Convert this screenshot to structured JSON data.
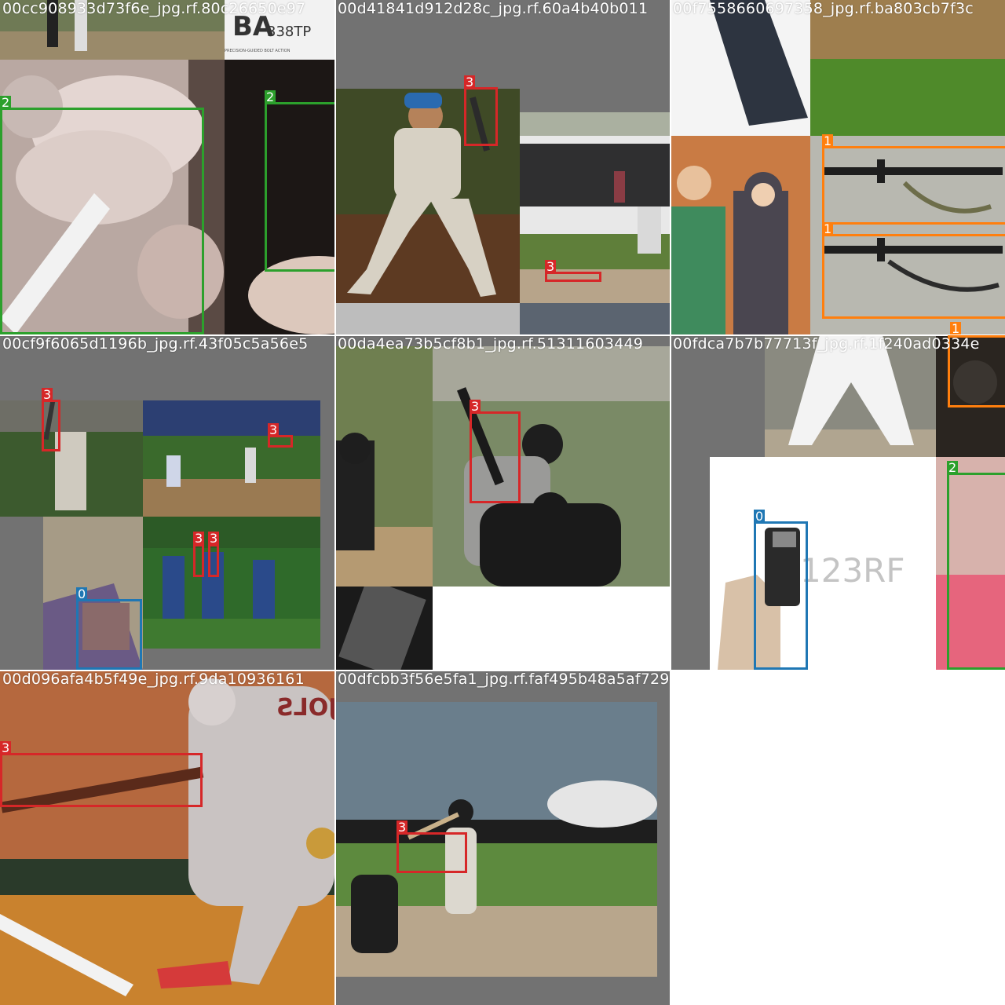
{
  "mosaic": {
    "tiles": [
      {
        "title": "00cc908933d73f6e_jpg.rf.80c26650e97",
        "labels": [
          "2",
          "2"
        ]
      },
      {
        "title": "00d41841d912d28c_jpg.rf.60a4b40b011",
        "labels": [
          "3",
          "3"
        ]
      },
      {
        "title": "00f7558660697358_jpg.rf.ba803cb7f3c",
        "labels": [
          "1",
          "1",
          "1"
        ]
      },
      {
        "title": "00cf9f6065d1196b_jpg.rf.43f05c5a56e5",
        "labels": [
          "3",
          "3",
          "3",
          "3",
          "0"
        ]
      },
      {
        "title": "00da4ea73b5cf8b1_jpg.rf.51311603449",
        "labels": [
          "3"
        ]
      },
      {
        "title": "00fdca7b7b77713f_jpg.rf.1f240ad0334e",
        "labels": [
          "2",
          "0"
        ]
      },
      {
        "title": "00d096afa4b5f49e_jpg.rf.9da10936161",
        "labels": [
          "3"
        ]
      },
      {
        "title": "00dfcbb3f56e5fa1_jpg.rf.faf495b48a5af729",
        "labels": [
          "3"
        ]
      }
    ],
    "scene_text": {
      "bolt_brand": "BA",
      "bolt_model": "338TP",
      "bolt_tagline": "PRECISION-GUIDED BOLT ACTION",
      "stock_watermark": "123RF",
      "jersey_text": "PUJOLS"
    },
    "class_colors": {
      "0": "#1f77b4",
      "1": "#ff7f0e",
      "2": "#2ca02c",
      "3": "#d62728"
    }
  }
}
